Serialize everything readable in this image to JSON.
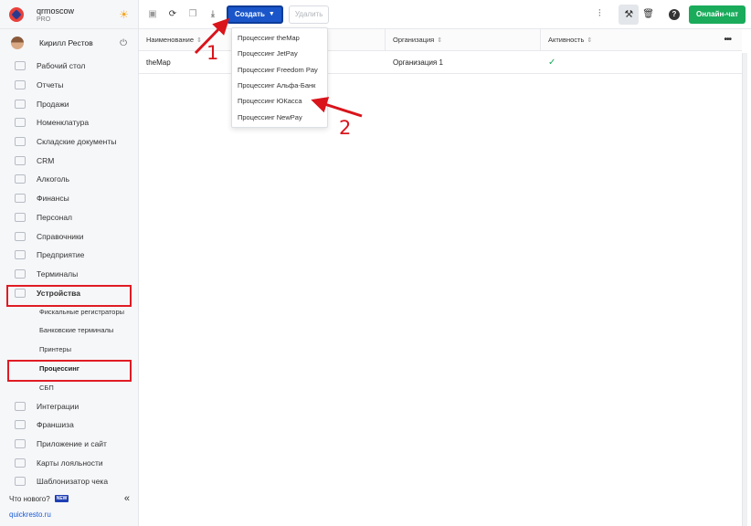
{
  "sidebar": {
    "brand_name": "qrmoscow",
    "brand_plan": "PRO",
    "user_name": "Кирилл Рестов",
    "items": [
      {
        "label": "Рабочий стол"
      },
      {
        "label": "Отчеты"
      },
      {
        "label": "Продажи"
      },
      {
        "label": "Номенклатура"
      },
      {
        "label": "Складские документы"
      },
      {
        "label": "CRM"
      },
      {
        "label": "Алкоголь"
      },
      {
        "label": "Финансы"
      },
      {
        "label": "Персонал"
      },
      {
        "label": "Справочники"
      },
      {
        "label": "Предприятие"
      },
      {
        "label": "Терминалы"
      },
      {
        "label": "Устройства"
      }
    ],
    "sub_items": [
      {
        "label": "Фискальные регистраторы"
      },
      {
        "label": "Банковские терминалы"
      },
      {
        "label": "Принтеры"
      },
      {
        "label": "Процессинг"
      },
      {
        "label": "СБП"
      }
    ],
    "items_after": [
      {
        "label": "Интеграции"
      },
      {
        "label": "Франшиза"
      },
      {
        "label": "Приложение и сайт"
      },
      {
        "label": "Карты лояльности"
      },
      {
        "label": "Шаблонизатор чека"
      }
    ],
    "whats_new": "Что нового?",
    "new_badge": "NEW",
    "collapse_glyph": "«",
    "site_link": "quickresto.ru"
  },
  "toolbar": {
    "create_label": "Создать",
    "delete_label": "Удалить",
    "chat_label": "Онлайн-чат",
    "help_glyph": "?"
  },
  "table": {
    "columns": [
      "Наименование",
      "Организация",
      "Активность"
    ],
    "rows": [
      {
        "name": "theMap",
        "organization": "Организация 1",
        "active": "✓"
      }
    ],
    "more_glyph": "•••"
  },
  "dropdown": {
    "items": [
      "Процессинг theMap",
      "Процессинг JetPay",
      "Процессинг Freedom Pay",
      "Процессинг Альфа-Банк",
      "Процессинг ЮКасса",
      "Процессинг NewPay"
    ]
  },
  "annotations": {
    "step1": "1",
    "step2": "2",
    "color": "#d9141b"
  }
}
